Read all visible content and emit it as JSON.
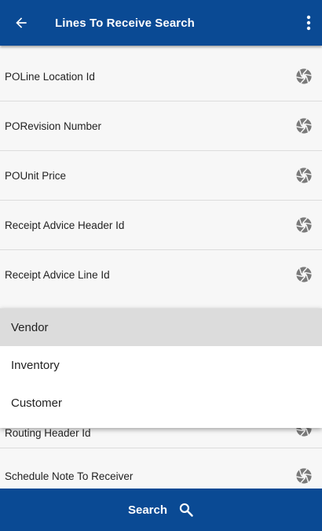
{
  "header": {
    "title": "Lines To Receive Search",
    "back_icon": "arrow-left-icon",
    "menu_icon": "more-vertical-icon"
  },
  "fields": [
    {
      "label": "POLine Location Id"
    },
    {
      "label": "PORevision Number"
    },
    {
      "label": "POUnit Price"
    },
    {
      "label": "Receipt Advice Header Id"
    },
    {
      "label": "Receipt Advice Line Id"
    }
  ],
  "hidden_fields": [
    {
      "label": "Routing Header Id"
    },
    {
      "label": "Schedule Note To Receiver"
    }
  ],
  "dropdown": {
    "options": [
      "Vendor",
      "Inventory",
      "Customer"
    ],
    "selected": "Vendor"
  },
  "footer": {
    "search_label": "Search",
    "search_icon": "search-icon"
  },
  "colors": {
    "primary": "#0a4a94",
    "selected_option": "#dcdcdc"
  }
}
